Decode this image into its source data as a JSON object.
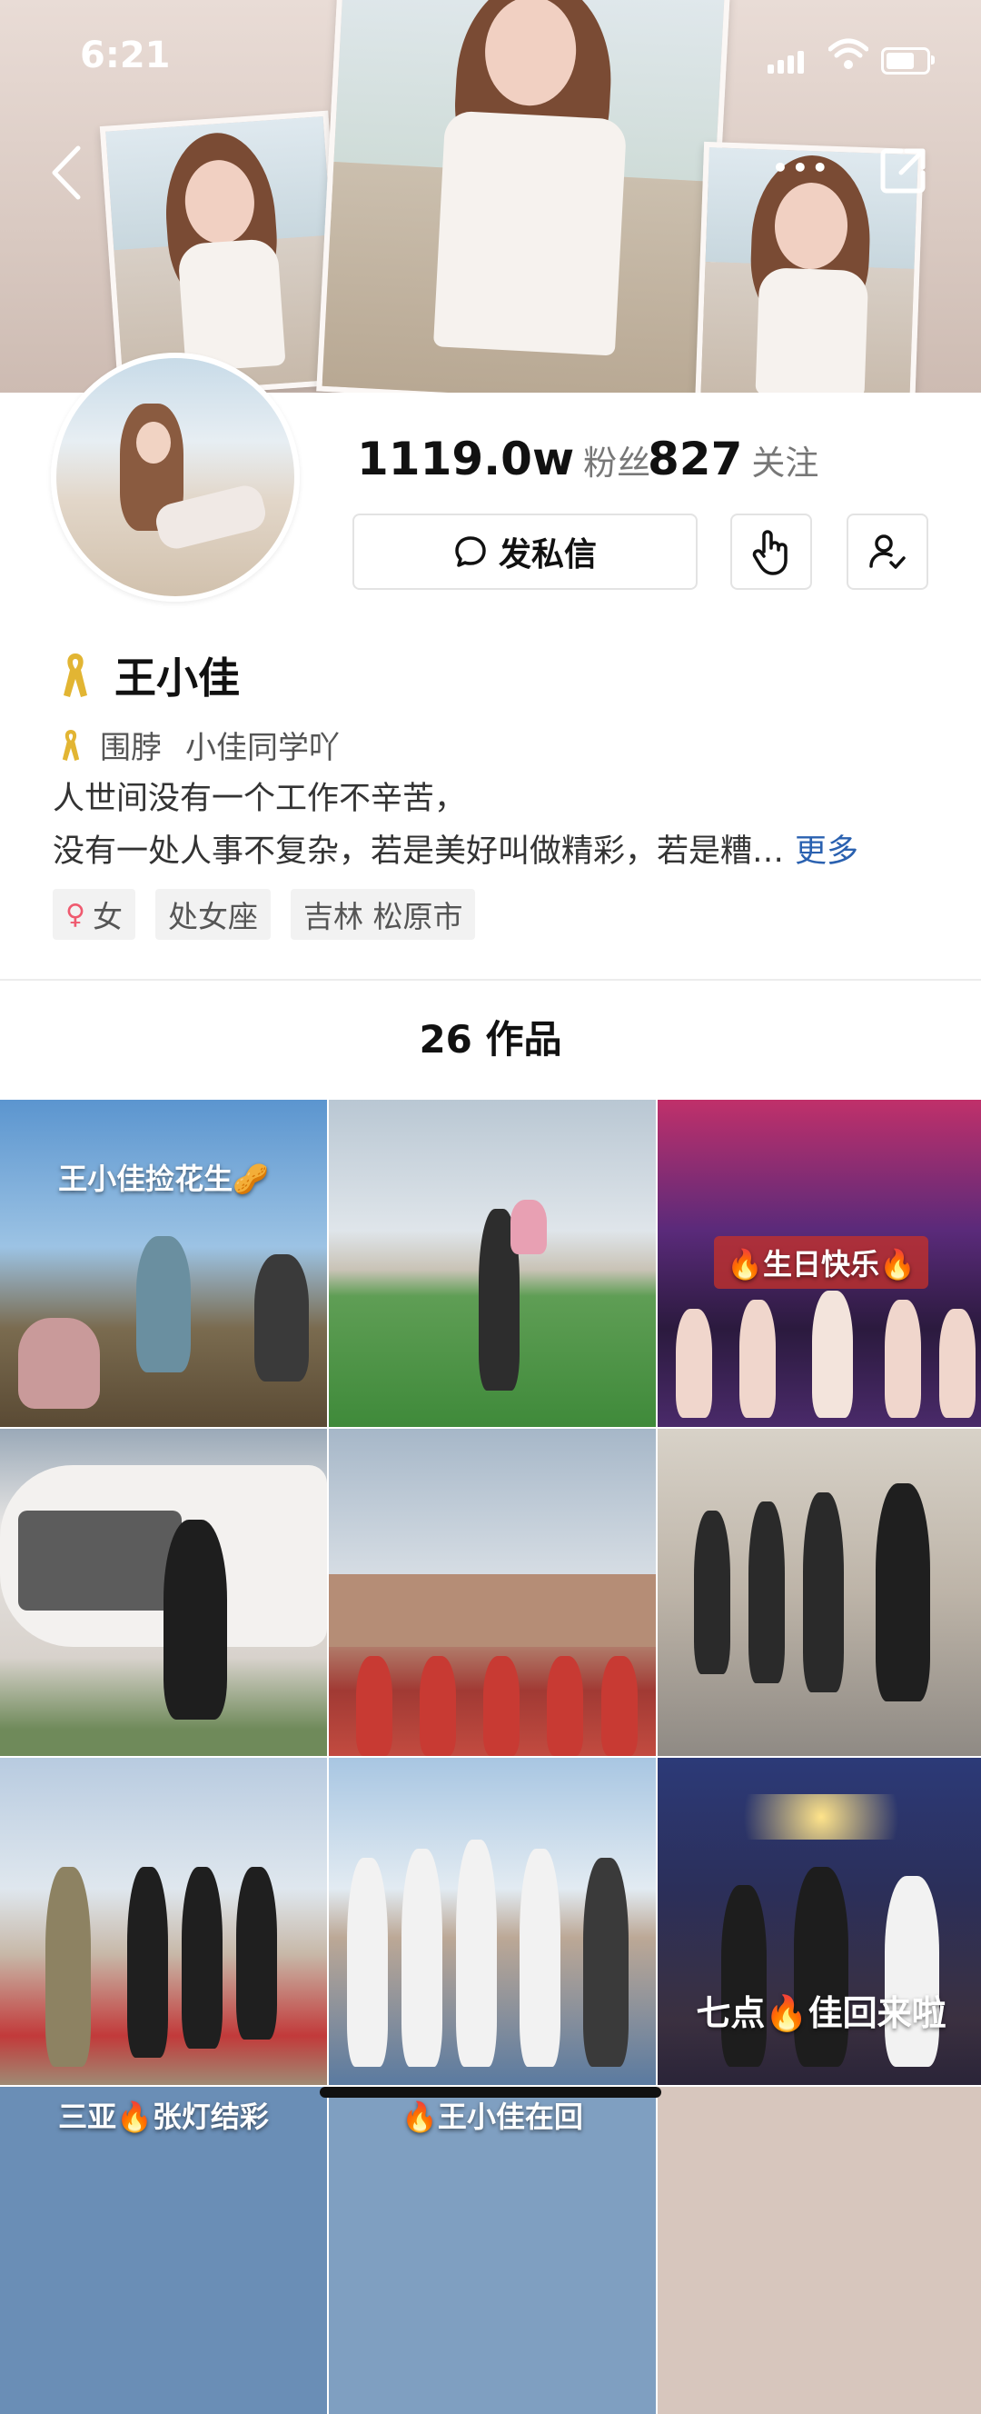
{
  "status_bar": {
    "time": "6:21"
  },
  "profile": {
    "followers_count": "1119.0w",
    "followers_label": "粉丝",
    "following_count": "827",
    "following_label": "关注",
    "message_button": "发私信",
    "name": "王小佳",
    "sub_prefix": "围脖",
    "sub_name": "小佳同学吖",
    "bio_line1": "人世间没有一个工作不辛苦，",
    "bio_line2": "没有一处人事不复杂，若是美好叫做精彩，若是糟…",
    "bio_more": "更多",
    "tags": [
      "女",
      "处女座",
      "吉林 松原市"
    ]
  },
  "works": {
    "count": "26",
    "label": "作品"
  },
  "grid": {
    "captions": [
      "王小佳捡花生🥜",
      "🔥生日快乐🔥",
      "七点🔥佳回来啦",
      "三亚🔥张灯结彩",
      "🔥王小佳在回"
    ]
  },
  "icons": {
    "back": "chevron-left-icon",
    "more": "more-dots-icon",
    "share": "share-icon",
    "message": "chat-bubble-icon",
    "touch": "tap-hand-icon",
    "follow": "user-check-icon",
    "ribbon": "gold-ribbon-icon",
    "gender": "female-icon"
  },
  "colors": {
    "link": "#2a61b0",
    "ribbon": "#e2b533",
    "female": "#ef5a6f"
  }
}
